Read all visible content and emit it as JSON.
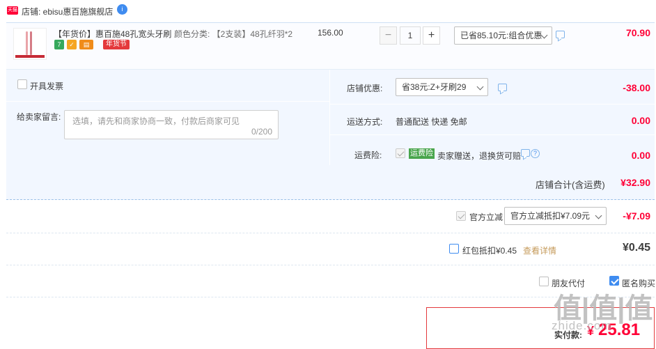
{
  "shop": {
    "badge": "天猫",
    "name": "店铺: ebisu惠百施旗舰店",
    "ww": "i"
  },
  "item": {
    "title": "【年货价】惠百施48孔宽头牙刷",
    "services": [
      "7",
      "✓",
      "▤"
    ],
    "festival_tag": "年货节",
    "sku_label": "颜色分类: 【2支装】48孔纤羽*2",
    "unit_price": "156.00",
    "quantity": "1",
    "qty_minus": "−",
    "qty_plus": "+",
    "promo_select": "已省85.10元:组合优惠",
    "total": "70.90"
  },
  "options": {
    "invoice_label": "开具发票",
    "message_label": "给卖家留言:",
    "message_placeholder": "选填，请先和商家协商一致，付款后商家可见",
    "message_count": "0/200",
    "shop_discount_label": "店铺优惠:",
    "shop_discount_select": "省38元:Z+牙刷29",
    "shop_discount_value": "-38.00",
    "shipping_label": "运送方式:",
    "shipping_value": "普通配送 快递 免邮",
    "shipping_amount": "0.00",
    "insurance_label": "运费险:",
    "insurance_tag": "运费险",
    "insurance_text": "卖家赠送，退换货可赔",
    "insurance_help": "?",
    "insurance_amount": "0.00"
  },
  "subtotal": {
    "label": "店铺合计(含运费)",
    "value": "¥32.90"
  },
  "official": {
    "label": "官方立减",
    "select": "官方立减抵扣¥7.09元",
    "value": "-¥7.09"
  },
  "redpacket": {
    "label": "红包抵扣¥0.45",
    "link": "查看详情",
    "value": "¥0.45"
  },
  "buy_options": {
    "friend_pay": "朋友代付",
    "anonymous": "匿名购买"
  },
  "payment": {
    "label": "实付款:",
    "currency": "¥",
    "value": "25.81"
  },
  "watermark": {
    "logo": "值|值|值",
    "text": "zhide.com"
  },
  "colors": {
    "accent_red": "#ff0036",
    "panel_blue": "#f2f7ff",
    "checkbox_blue": "#3f8cf0",
    "tag_green": "#49a54c"
  }
}
